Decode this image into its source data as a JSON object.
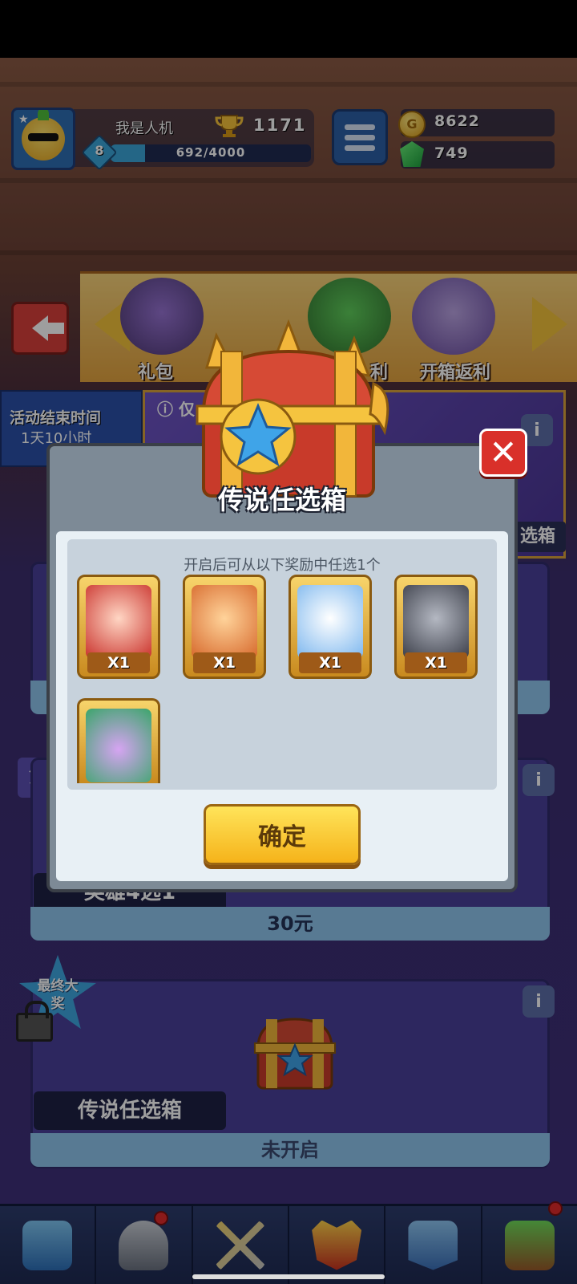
{
  "player": {
    "name": "我是人机",
    "trophies": "1171",
    "level": "8",
    "xp_text": "692/4000",
    "xp_progress": 0.173
  },
  "currency": {
    "gold": "8622",
    "gems": "749"
  },
  "categories": [
    {
      "label": "礼包",
      "icon": "gift-pack-icon"
    },
    {
      "label": "利",
      "icon": "gem-pot-icon"
    },
    {
      "label": "开箱返利",
      "icon": "chest-rebate-icon"
    }
  ],
  "activity": {
    "timer_label": "活动结束时间",
    "timer_value": "1天10小时",
    "notice_prefix": "仅",
    "banner_tag": "选箱"
  },
  "cards": {
    "card2_tag": "第",
    "card2_title": "英雄4选1",
    "card2_price": "30元",
    "final_tag": "最终大奖",
    "final_title": "传说任选箱",
    "final_status": "未开启"
  },
  "modal": {
    "title": "传说任选箱",
    "subtitle": "开启后可从以下奖励中任选1个",
    "confirm_label": "确定",
    "close_label": "✕",
    "rewards": [
      {
        "name": "fan-girl-hero",
        "qty": "X1"
      },
      {
        "name": "monkey-king-hero",
        "qty": "X1"
      },
      {
        "name": "yeti-hero",
        "qty": "X1"
      },
      {
        "name": "dark-knight-hero",
        "qty": "X1"
      },
      {
        "name": "medusa-hero",
        "qty": ""
      }
    ]
  },
  "bottom_nav": [
    {
      "name": "shop",
      "icon": "treasure-chest-icon"
    },
    {
      "name": "heroes",
      "icon": "knight-helmet-icon"
    },
    {
      "name": "battle",
      "icon": "crossed-swords-icon"
    },
    {
      "name": "rank",
      "icon": "crown-shield-icon"
    },
    {
      "name": "guild",
      "icon": "guild-banner-icon"
    },
    {
      "name": "garden",
      "icon": "sprout-icon"
    }
  ]
}
